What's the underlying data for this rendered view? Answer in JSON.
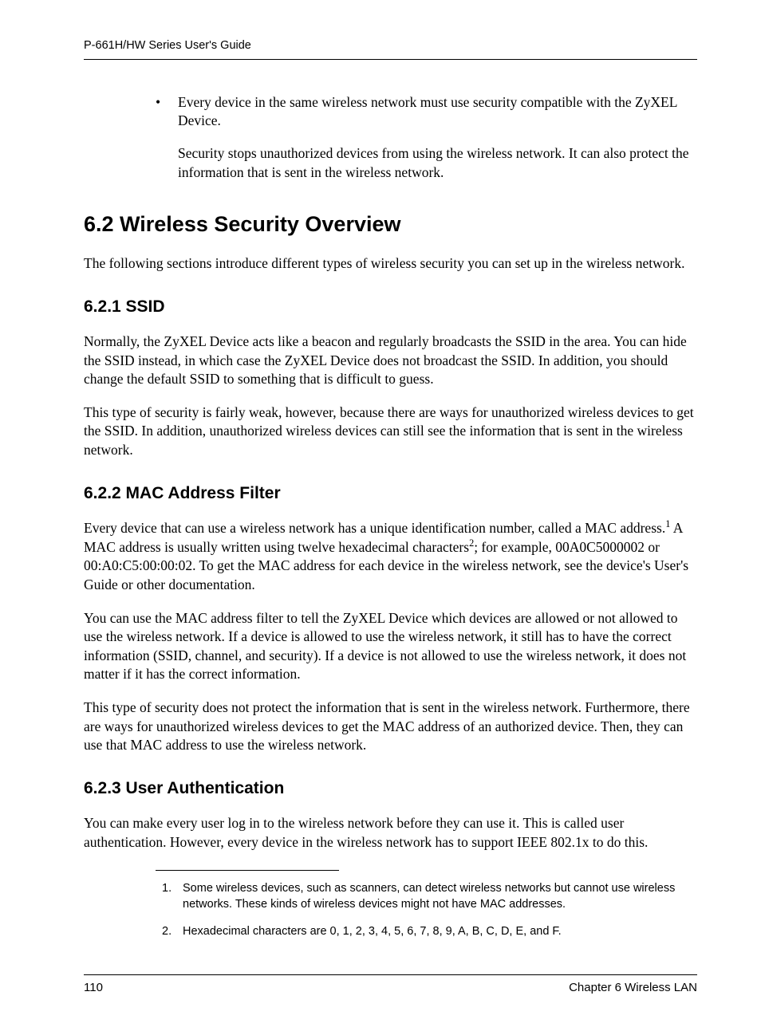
{
  "header": {
    "running_title": "P-661H/HW Series User's Guide"
  },
  "bullet": {
    "mark": "•",
    "line1": "Every device in the same wireless network must use security compatible with the ZyXEL Device.",
    "line2": "Security stops unauthorized devices from using the wireless network. It can also protect the information that is sent in the wireless network."
  },
  "sec62": {
    "title": "6.2  Wireless Security Overview",
    "p1": "The following sections introduce different types of wireless security you can set up in the wireless network."
  },
  "sec621": {
    "title": "6.2.1  SSID",
    "p1": "Normally, the ZyXEL Device acts like a beacon and regularly broadcasts the SSID in the area. You can hide the SSID instead, in which case the ZyXEL Device does not broadcast the SSID. In addition, you should change the default SSID to something that is difficult to guess.",
    "p2": "This type of security is fairly weak, however, because there are ways for unauthorized wireless devices to get the SSID. In addition, unauthorized wireless devices can still see the information that is sent in the wireless network."
  },
  "sec622": {
    "title": "6.2.2  MAC Address Filter",
    "p1_a": "Every device that can use a wireless network has a unique identification number, called a MAC address.",
    "p1_sup1": "1",
    "p1_b": " A MAC address is usually written using twelve hexadecimal characters",
    "p1_sup2": "2",
    "p1_c": "; for example, 00A0C5000002 or 00:A0:C5:00:00:02. To get the MAC address for each device in the wireless network, see the device's User's Guide or other documentation.",
    "p2": "You can use the MAC address filter to tell the ZyXEL Device which devices are allowed or not allowed to use the wireless network. If a device is allowed to use the wireless network, it still has to have the correct information (SSID, channel, and security). If a device is not allowed to use the wireless network, it does not matter if it has the correct information.",
    "p3": "This type of security does not protect the information that is sent in the wireless network. Furthermore, there are ways for unauthorized wireless devices to get the MAC address of an authorized device. Then, they can use that MAC address to use the wireless network."
  },
  "sec623": {
    "title": "6.2.3  User Authentication",
    "p1": "You can make every user log in to the wireless network before they can use it. This is called user authentication. However, every device in the wireless network has to support IEEE 802.1x to do this."
  },
  "footnotes": {
    "n1_num": "1.",
    "n1_txt": "Some wireless devices, such as scanners, can detect wireless networks but cannot use wireless networks. These kinds of wireless devices might not have MAC addresses.",
    "n2_num": "2.",
    "n2_txt": "Hexadecimal characters are 0, 1, 2, 3, 4, 5, 6, 7, 8, 9, A, B, C, D, E, and F."
  },
  "footer": {
    "page_num": "110",
    "chapter": "Chapter 6 Wireless LAN"
  }
}
